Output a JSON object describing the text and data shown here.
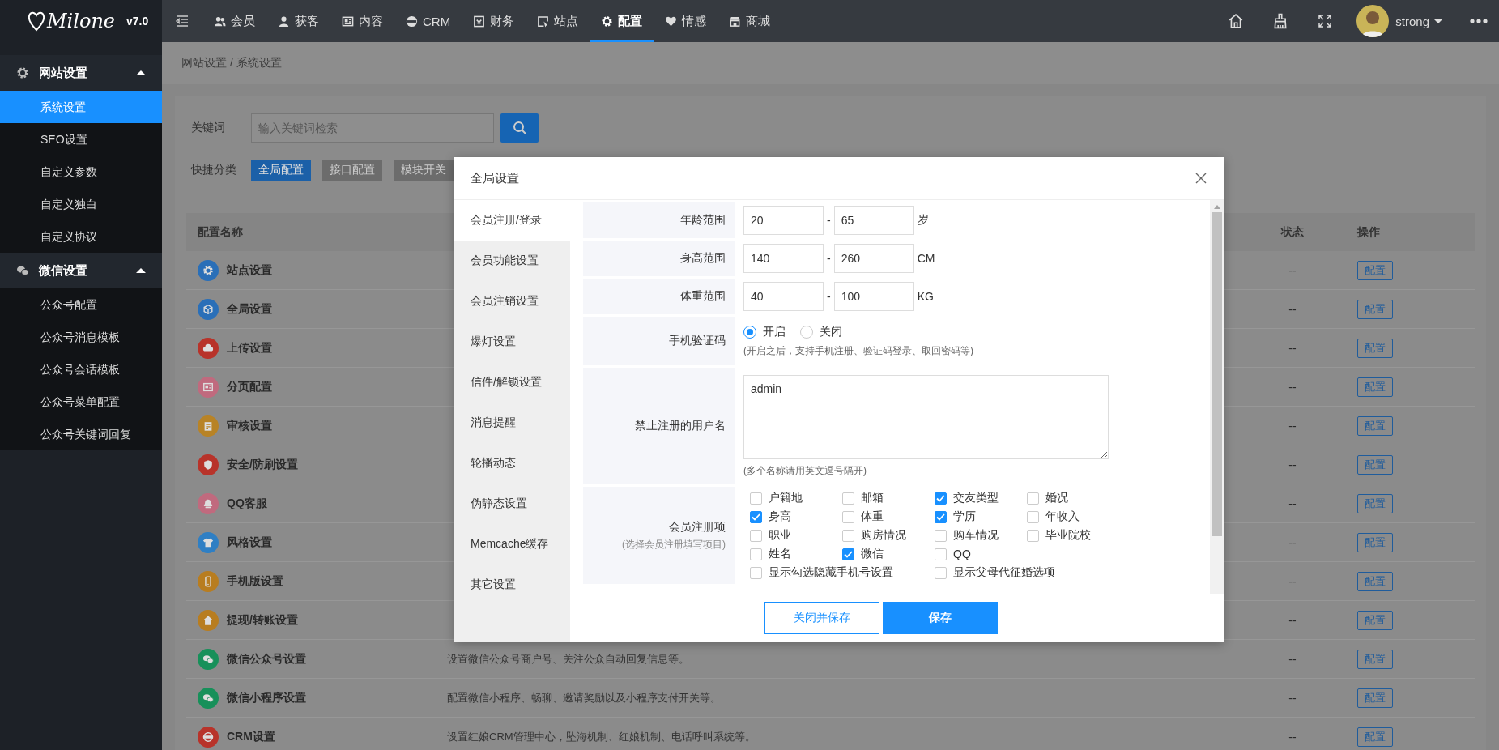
{
  "logo": {
    "text": "Milone",
    "version": "v7.0"
  },
  "topnav": [
    {
      "label": "会员",
      "kind": "users",
      "selected": false
    },
    {
      "label": "获客",
      "kind": "user",
      "selected": false
    },
    {
      "label": "内容",
      "kind": "news",
      "selected": false
    },
    {
      "label": "CRM",
      "kind": "badge",
      "selected": false
    },
    {
      "label": "财务",
      "kind": "ledger",
      "selected": false
    },
    {
      "label": "站点",
      "kind": "pointer",
      "selected": false
    },
    {
      "label": "配置",
      "kind": "gear",
      "selected": true
    },
    {
      "label": "情感",
      "kind": "heart",
      "selected": false
    },
    {
      "label": "商城",
      "kind": "store",
      "selected": false
    }
  ],
  "user": {
    "name": "strong"
  },
  "sidebar": [
    {
      "label": "网站设置",
      "kind": "gear",
      "expanded": true,
      "children": [
        {
          "label": "系统设置",
          "selected": true
        },
        {
          "label": "SEO设置",
          "selected": false
        },
        {
          "label": "自定义参数",
          "selected": false
        },
        {
          "label": "自定义独白",
          "selected": false
        },
        {
          "label": "自定义协议",
          "selected": false
        }
      ]
    },
    {
      "label": "微信设置",
      "kind": "chat",
      "expanded": true,
      "children": [
        {
          "label": "公众号配置",
          "selected": false
        },
        {
          "label": "公众号消息模板",
          "selected": false
        },
        {
          "label": "公众号会话模板",
          "selected": false
        },
        {
          "label": "公众号菜单配置",
          "selected": false
        },
        {
          "label": "公众号关键词回复",
          "selected": false
        }
      ]
    }
  ],
  "breadcrumb": "网站设置 / 系统设置",
  "search": {
    "label": "关键词",
    "placeholder": "输入关键词检索"
  },
  "quick": {
    "label": "快捷分类",
    "items": [
      {
        "label": "全局配置",
        "selected": true
      },
      {
        "label": "接口配置",
        "selected": false
      },
      {
        "label": "模块开关",
        "selected": false
      }
    ]
  },
  "table": {
    "columns": [
      "配置名称",
      "状态",
      "操作"
    ],
    "rows": [
      {
        "name": "站点设置",
        "kind": "gear",
        "color": "#2a6fb8",
        "status": "--",
        "action": "配置"
      },
      {
        "name": "全局设置",
        "kind": "cube",
        "color": "#2a6fb8",
        "status": "--",
        "action": "配置"
      },
      {
        "name": "上传设置",
        "kind": "cloud",
        "color": "#b8332a",
        "status": "--",
        "action": "配置"
      },
      {
        "name": "分页配置",
        "kind": "page",
        "color": "#c06a7e",
        "status": "--",
        "action": "配置"
      },
      {
        "name": "审核设置",
        "kind": "clipboard",
        "color": "#b88326",
        "status": "--",
        "action": "配置"
      },
      {
        "name": "安全/防刷设置",
        "kind": "shield",
        "color": "#b8332a",
        "status": "--",
        "action": "配置"
      },
      {
        "name": "QQ客服",
        "kind": "bell",
        "color": "#c06a7e",
        "status": "--",
        "action": "配置"
      },
      {
        "name": "风格设置",
        "kind": "shirt",
        "color": "#2f7fc4",
        "status": "--",
        "action": "配置"
      },
      {
        "name": "手机版设置",
        "kind": "phone",
        "color": "#b87d20",
        "status": "--",
        "action": "配置"
      },
      {
        "name": "提现/转账设置",
        "kind": "house",
        "color": "#b87d20",
        "status": "--",
        "action": "配置"
      },
      {
        "name": "微信公众号设置",
        "kind": "chat",
        "color": "#17905a",
        "desc": "设置微信公众号商户号、关注公众自动回复信息等。",
        "status": "--",
        "action": "配置"
      },
      {
        "name": "微信小程序设置",
        "kind": "chat",
        "color": "#17905a",
        "desc": "配置微信小程序、畅聊、邀请奖励以及小程序支付开关等。",
        "status": "--",
        "action": "配置"
      },
      {
        "name": "CRM设置",
        "kind": "crm",
        "color": "#b8332a",
        "desc": "设置红娘CRM管理中心，坠海机制、红娘机制、电话呼叫系统等。",
        "status": "--",
        "action": "配置"
      }
    ]
  },
  "modal": {
    "title": "全局设置",
    "tabs": [
      {
        "label": "会员注册/登录",
        "selected": true
      },
      {
        "label": "会员功能设置",
        "selected": false
      },
      {
        "label": "会员注销设置",
        "selected": false
      },
      {
        "label": "爆灯设置",
        "selected": false
      },
      {
        "label": "信件/解锁设置",
        "selected": false
      },
      {
        "label": "消息提醒",
        "selected": false
      },
      {
        "label": "轮播动态",
        "selected": false
      },
      {
        "label": "伪静态设置",
        "selected": false
      },
      {
        "label": "Memcache缓存",
        "selected": false
      },
      {
        "label": "其它设置",
        "selected": false
      }
    ],
    "fields": [
      {
        "kind": "range",
        "label": "年龄范围",
        "min": "20",
        "sep": "-",
        "max": "65",
        "unit": "岁"
      },
      {
        "kind": "range",
        "label": "身高范围",
        "min": "140",
        "sep": "-",
        "max": "260",
        "unit": "CM"
      },
      {
        "kind": "range",
        "label": "体重范围",
        "min": "40",
        "sep": "-",
        "max": "100",
        "unit": "KG"
      },
      {
        "kind": "radio",
        "label": "手机验证码",
        "options": [
          {
            "label": "开启",
            "selected": true
          },
          {
            "label": "关闭",
            "selected": false
          }
        ],
        "hint": "(开启之后，支持手机注册、验证码登录、取回密码等)"
      },
      {
        "kind": "textarea",
        "label": "禁止注册的用户名",
        "value": "admin",
        "hint": "(多个名称请用英文逗号隔开)"
      },
      {
        "kind": "checkboxes",
        "label": "会员注册项",
        "sublabel": "(选择会员注册填写项目)",
        "options": [
          {
            "label": "户籍地",
            "checked": false
          },
          {
            "label": "邮箱",
            "checked": false
          },
          {
            "label": "交友类型",
            "checked": true
          },
          {
            "label": "婚况",
            "checked": false
          },
          {
            "label": "身高",
            "checked": true
          },
          {
            "label": "体重",
            "checked": false
          },
          {
            "label": "学历",
            "checked": true
          },
          {
            "label": "年收入",
            "checked": false
          },
          {
            "label": "职业",
            "checked": false
          },
          {
            "label": "购房情况",
            "checked": false
          },
          {
            "label": "购车情况",
            "checked": false
          },
          {
            "label": "毕业院校",
            "checked": false
          },
          {
            "label": "姓名",
            "checked": false
          },
          {
            "label": "微信",
            "checked": true
          },
          {
            "label": "QQ",
            "checked": false
          },
          {
            "label": "显示勾选隐藏手机号设置",
            "checked": false
          },
          {
            "label": "显示父母代征婚选项",
            "checked": false
          }
        ]
      }
    ],
    "buttons": [
      {
        "label": "关闭并保存",
        "kind": "outline"
      },
      {
        "label": "保存",
        "kind": "primary"
      }
    ]
  }
}
